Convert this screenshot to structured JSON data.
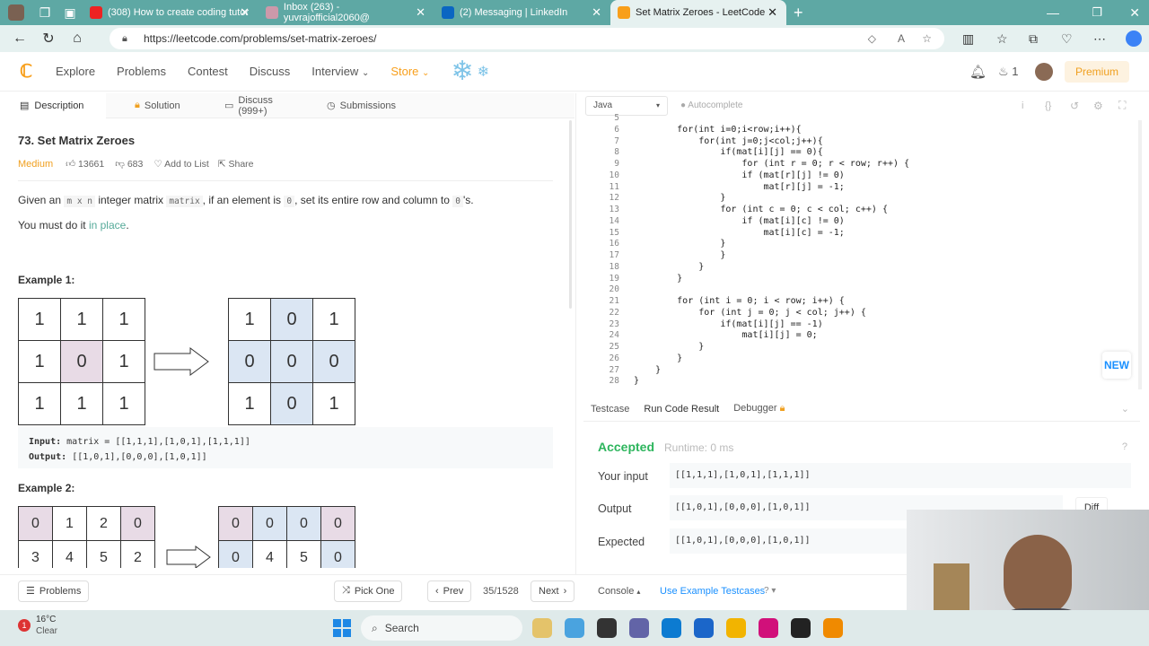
{
  "browser": {
    "tabs": [
      {
        "title": "(308) How to create coding tutor",
        "color": "#e22"
      },
      {
        "title": "Inbox (263) - yuvrajofficial2060@",
        "color": "#c9a"
      },
      {
        "title": "(2) Messaging | LinkedIn",
        "color": "#0a66c2"
      },
      {
        "title": "Set Matrix Zeroes - LeetCode",
        "color": "#f89f1b"
      }
    ],
    "url": "https://leetcode.com/problems/set-matrix-zeroes/"
  },
  "nav": {
    "items": [
      "Explore",
      "Problems",
      "Contest",
      "Discuss",
      "Interview",
      "Store"
    ],
    "fire_count": "1",
    "premium": "Premium"
  },
  "panel_tabs": [
    "Description",
    "Solution",
    "Discuss (999+)",
    "Submissions"
  ],
  "problem": {
    "title": "73. Set Matrix Zeroes",
    "difficulty": "Medium",
    "likes": "13661",
    "dislikes": "683",
    "add_to_list": "Add to List",
    "share": "Share",
    "desc_parts": [
      "Given an ",
      "m x n",
      " integer matrix ",
      "matrix",
      ", if an element is ",
      "0",
      ", set its entire row and column to ",
      "0",
      "'s."
    ],
    "place_pre": "You must do it ",
    "place_link": "in place",
    "place_post": ".",
    "example1_heading": "Example 1:",
    "example1_in_label": "Input:",
    "example1_input": "matrix = [[1,1,1],[1,0,1],[1,1,1]]",
    "example1_out_label": "Output:",
    "example1_output": "[[1,0,1],[0,0,0],[1,0,1]]",
    "example2_heading": "Example 2:",
    "ex1_in": [
      [
        "1",
        "1",
        "1"
      ],
      [
        "1",
        "0",
        "1"
      ],
      [
        "1",
        "1",
        "1"
      ]
    ],
    "ex1_out": [
      [
        "1",
        "0",
        "1"
      ],
      [
        "0",
        "0",
        "0"
      ],
      [
        "1",
        "0",
        "1"
      ]
    ],
    "ex2_in": [
      [
        "0",
        "1",
        "2",
        "0"
      ],
      [
        "3",
        "4",
        "5",
        "2"
      ]
    ],
    "ex2_out": [
      [
        "0",
        "0",
        "0",
        "0"
      ],
      [
        "0",
        "4",
        "5",
        "0"
      ]
    ]
  },
  "editor": {
    "language": "Java",
    "autocomplete": "Autocomplete",
    "new_badge": "NEW",
    "lines": [
      {
        "n": "5",
        "code": ""
      },
      {
        "n": "6",
        "code": "        for(int i=0;i<row;i++){"
      },
      {
        "n": "7",
        "code": "            for(int j=0;j<col;j++){"
      },
      {
        "n": "8",
        "code": "                if(mat[i][j] == 0){"
      },
      {
        "n": "9",
        "code": "                    for (int r = 0; r < row; r++) {"
      },
      {
        "n": "10",
        "code": "                    if (mat[r][j] != 0)"
      },
      {
        "n": "11",
        "code": "                        mat[r][j] = -1;"
      },
      {
        "n": "12",
        "code": "                }"
      },
      {
        "n": "13",
        "code": "                for (int c = 0; c < col; c++) {"
      },
      {
        "n": "14",
        "code": "                    if (mat[i][c] != 0)"
      },
      {
        "n": "15",
        "code": "                        mat[i][c] = -1;"
      },
      {
        "n": "16",
        "code": "                }"
      },
      {
        "n": "17",
        "code": "                }"
      },
      {
        "n": "18",
        "code": "            }"
      },
      {
        "n": "19",
        "code": "        }"
      },
      {
        "n": "20",
        "code": ""
      },
      {
        "n": "21",
        "code": "        for (int i = 0; i < row; i++) {"
      },
      {
        "n": "22",
        "code": "            for (int j = 0; j < col; j++) {"
      },
      {
        "n": "23",
        "code": "                if(mat[i][j] == -1)"
      },
      {
        "n": "24",
        "code": "                    mat[i][j] = 0;"
      },
      {
        "n": "25",
        "code": "            }"
      },
      {
        "n": "26",
        "code": "        }"
      },
      {
        "n": "27",
        "code": "    }"
      },
      {
        "n": "28",
        "code": "}"
      }
    ]
  },
  "result": {
    "tabs": [
      "Testcase",
      "Run Code Result",
      "Debugger"
    ],
    "status": "Accepted",
    "runtime": "Runtime: 0 ms",
    "your_input_label": "Your input",
    "your_input": "[[1,1,1],[1,0,1],[1,1,1]]",
    "output_label": "Output",
    "output": "[[1,0,1],[0,0,0],[1,0,1]]",
    "diff": "Diff",
    "expected_label": "Expected",
    "expected": "[[1,0,1],[0,0,0],[1,0,1]]"
  },
  "bottom": {
    "problems": "Problems",
    "pick_one": "Pick One",
    "prev": "Prev",
    "counter": "35/1528",
    "next": "Next",
    "console": "Console",
    "use_example": "Use Example Testcases"
  },
  "taskbar": {
    "temp": "16°C",
    "weather": "Clear",
    "search": "Search",
    "badge": "1"
  },
  "colors": {
    "accent": "#f89f1b",
    "accepted": "#2db55d",
    "link": "#1a90ff",
    "pink": "#e8dbe6",
    "blue": "#dbe6f3"
  }
}
